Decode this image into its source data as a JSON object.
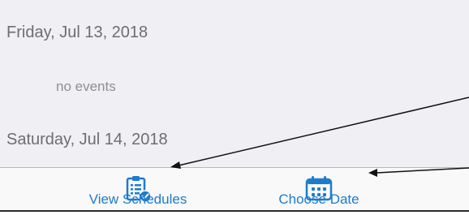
{
  "list": {
    "days": [
      {
        "date": "Friday, Jul 13, 2018",
        "events_text": "no events"
      },
      {
        "date": "Saturday, Jul 14, 2018"
      }
    ]
  },
  "tab_bar": {
    "items": [
      {
        "label": "View Schedules",
        "icon": "clipboard-check-icon"
      },
      {
        "label": "Choose Date",
        "icon": "calendar-icon"
      }
    ]
  },
  "colors": {
    "accent": "#1f7bcc",
    "list_background": "#efeff4",
    "tab_background": "#f9f9f9"
  }
}
